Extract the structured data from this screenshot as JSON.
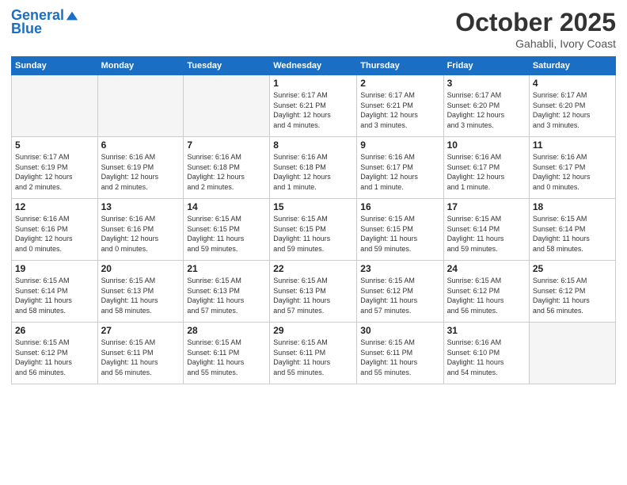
{
  "header": {
    "logo_line1": "General",
    "logo_line2": "Blue",
    "month": "October 2025",
    "location": "Gahabli, Ivory Coast"
  },
  "weekdays": [
    "Sunday",
    "Monday",
    "Tuesday",
    "Wednesday",
    "Thursday",
    "Friday",
    "Saturday"
  ],
  "weeks": [
    [
      {
        "day": "",
        "info": ""
      },
      {
        "day": "",
        "info": ""
      },
      {
        "day": "",
        "info": ""
      },
      {
        "day": "1",
        "info": "Sunrise: 6:17 AM\nSunset: 6:21 PM\nDaylight: 12 hours\nand 4 minutes."
      },
      {
        "day": "2",
        "info": "Sunrise: 6:17 AM\nSunset: 6:21 PM\nDaylight: 12 hours\nand 3 minutes."
      },
      {
        "day": "3",
        "info": "Sunrise: 6:17 AM\nSunset: 6:20 PM\nDaylight: 12 hours\nand 3 minutes."
      },
      {
        "day": "4",
        "info": "Sunrise: 6:17 AM\nSunset: 6:20 PM\nDaylight: 12 hours\nand 3 minutes."
      }
    ],
    [
      {
        "day": "5",
        "info": "Sunrise: 6:17 AM\nSunset: 6:19 PM\nDaylight: 12 hours\nand 2 minutes."
      },
      {
        "day": "6",
        "info": "Sunrise: 6:16 AM\nSunset: 6:19 PM\nDaylight: 12 hours\nand 2 minutes."
      },
      {
        "day": "7",
        "info": "Sunrise: 6:16 AM\nSunset: 6:18 PM\nDaylight: 12 hours\nand 2 minutes."
      },
      {
        "day": "8",
        "info": "Sunrise: 6:16 AM\nSunset: 6:18 PM\nDaylight: 12 hours\nand 1 minute."
      },
      {
        "day": "9",
        "info": "Sunrise: 6:16 AM\nSunset: 6:17 PM\nDaylight: 12 hours\nand 1 minute."
      },
      {
        "day": "10",
        "info": "Sunrise: 6:16 AM\nSunset: 6:17 PM\nDaylight: 12 hours\nand 1 minute."
      },
      {
        "day": "11",
        "info": "Sunrise: 6:16 AM\nSunset: 6:17 PM\nDaylight: 12 hours\nand 0 minutes."
      }
    ],
    [
      {
        "day": "12",
        "info": "Sunrise: 6:16 AM\nSunset: 6:16 PM\nDaylight: 12 hours\nand 0 minutes."
      },
      {
        "day": "13",
        "info": "Sunrise: 6:16 AM\nSunset: 6:16 PM\nDaylight: 12 hours\nand 0 minutes."
      },
      {
        "day": "14",
        "info": "Sunrise: 6:15 AM\nSunset: 6:15 PM\nDaylight: 11 hours\nand 59 minutes."
      },
      {
        "day": "15",
        "info": "Sunrise: 6:15 AM\nSunset: 6:15 PM\nDaylight: 11 hours\nand 59 minutes."
      },
      {
        "day": "16",
        "info": "Sunrise: 6:15 AM\nSunset: 6:15 PM\nDaylight: 11 hours\nand 59 minutes."
      },
      {
        "day": "17",
        "info": "Sunrise: 6:15 AM\nSunset: 6:14 PM\nDaylight: 11 hours\nand 59 minutes."
      },
      {
        "day": "18",
        "info": "Sunrise: 6:15 AM\nSunset: 6:14 PM\nDaylight: 11 hours\nand 58 minutes."
      }
    ],
    [
      {
        "day": "19",
        "info": "Sunrise: 6:15 AM\nSunset: 6:14 PM\nDaylight: 11 hours\nand 58 minutes."
      },
      {
        "day": "20",
        "info": "Sunrise: 6:15 AM\nSunset: 6:13 PM\nDaylight: 11 hours\nand 58 minutes."
      },
      {
        "day": "21",
        "info": "Sunrise: 6:15 AM\nSunset: 6:13 PM\nDaylight: 11 hours\nand 57 minutes."
      },
      {
        "day": "22",
        "info": "Sunrise: 6:15 AM\nSunset: 6:13 PM\nDaylight: 11 hours\nand 57 minutes."
      },
      {
        "day": "23",
        "info": "Sunrise: 6:15 AM\nSunset: 6:12 PM\nDaylight: 11 hours\nand 57 minutes."
      },
      {
        "day": "24",
        "info": "Sunrise: 6:15 AM\nSunset: 6:12 PM\nDaylight: 11 hours\nand 56 minutes."
      },
      {
        "day": "25",
        "info": "Sunrise: 6:15 AM\nSunset: 6:12 PM\nDaylight: 11 hours\nand 56 minutes."
      }
    ],
    [
      {
        "day": "26",
        "info": "Sunrise: 6:15 AM\nSunset: 6:12 PM\nDaylight: 11 hours\nand 56 minutes."
      },
      {
        "day": "27",
        "info": "Sunrise: 6:15 AM\nSunset: 6:11 PM\nDaylight: 11 hours\nand 56 minutes."
      },
      {
        "day": "28",
        "info": "Sunrise: 6:15 AM\nSunset: 6:11 PM\nDaylight: 11 hours\nand 55 minutes."
      },
      {
        "day": "29",
        "info": "Sunrise: 6:15 AM\nSunset: 6:11 PM\nDaylight: 11 hours\nand 55 minutes."
      },
      {
        "day": "30",
        "info": "Sunrise: 6:15 AM\nSunset: 6:11 PM\nDaylight: 11 hours\nand 55 minutes."
      },
      {
        "day": "31",
        "info": "Sunrise: 6:16 AM\nSunset: 6:10 PM\nDaylight: 11 hours\nand 54 minutes."
      },
      {
        "day": "",
        "info": ""
      }
    ]
  ]
}
